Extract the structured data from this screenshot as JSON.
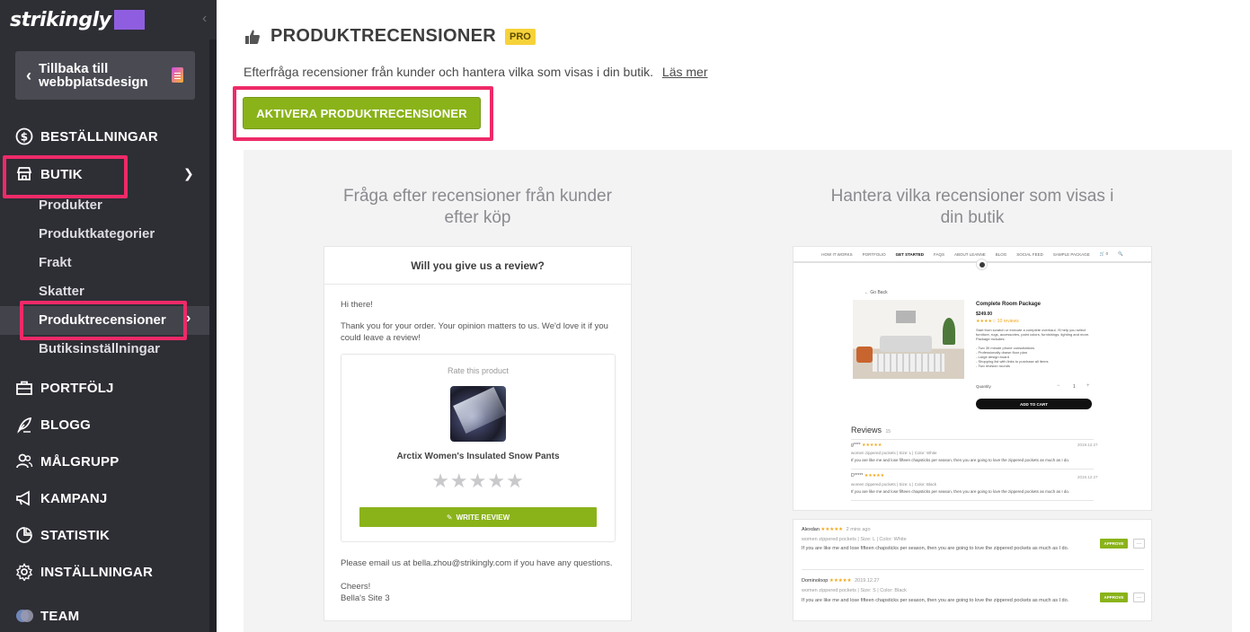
{
  "app": {
    "logo": "strikingly"
  },
  "sidebar": {
    "back_label": "Tillbaka till webbplatsdesign",
    "items": [
      {
        "label": "BESTÄLLNINGAR",
        "icon": "dollar-circle-icon"
      },
      {
        "label": "BUTIK",
        "icon": "store-icon"
      },
      {
        "label": "PORTFÖLJ",
        "icon": "briefcase-icon"
      },
      {
        "label": "BLOGG",
        "icon": "feather-icon"
      },
      {
        "label": "MÅLGRUPP",
        "icon": "users-icon"
      },
      {
        "label": "KAMPANJ",
        "icon": "megaphone-icon"
      },
      {
        "label": "STATISTIK",
        "icon": "pie-chart-icon"
      },
      {
        "label": "INSTÄLLNINGAR",
        "icon": "gear-icon"
      },
      {
        "label": "TEAM",
        "icon": "team-avatar-icon"
      }
    ],
    "butik_sub": [
      {
        "label": "Produkter"
      },
      {
        "label": "Produktkategorier"
      },
      {
        "label": "Frakt"
      },
      {
        "label": "Skatter"
      },
      {
        "label": "Produktrecensioner",
        "active": true
      },
      {
        "label": "Butiksinställningar"
      }
    ]
  },
  "header": {
    "title": "PRODUKTRECENSIONER",
    "badge": "PRO",
    "description": "Efterfråga recensioner från kunder och hantera vilka som visas i din butik.",
    "learn_more": "Läs mer",
    "activate_button": "AKTIVERA PRODUKTRECENSIONER"
  },
  "left_column": {
    "title": "Fråga efter recensioner från kunder efter köp",
    "email": {
      "heading": "Will you give us a review?",
      "greeting": "Hi there!",
      "body": "Thank you for your order. Your opinion matters to us. We'd love it if you could leave a review!",
      "rate_label": "Rate this product",
      "product_name": "Arctix Women's Insulated Snow Pants",
      "stars": "★★★★★",
      "write_review": "WRITE REVIEW",
      "footer": "Please email us at bella.zhou@strikingly.com if you have any questions.",
      "signoff": "Cheers!",
      "site": "Bella's Site 3"
    }
  },
  "right_column": {
    "title": "Hantera vilka recensioner som visas i din butik",
    "store_nav": [
      "HOW IT WORKS",
      "PORTFOLIO",
      "GET STARTED",
      "FAQS",
      "ABOUT LEANNE",
      "BLOG",
      "SOCIAL FEED",
      "SAMPLE PACKAGE",
      "🛒 0",
      "🔍"
    ],
    "go_back": "← Go Back",
    "product_title": "Complete Room Package",
    "price": "$249.00",
    "product_reviews_count": "★★★★☆ 10 reviews",
    "product_desc": "Start from scratch or execute a complete overhaul, I'll help you select furniture, rugs, accessories, paint colors, furnishings, lighting and more. Package includes:",
    "product_list": [
      "- Two 30 minute phone consultations",
      "- Professionally drawn floor plan",
      "- Large design board",
      "- Shopping list with links to purchase all items",
      "- Two revision rounds"
    ],
    "quantity_label": "Quantity",
    "quantity_value": "1",
    "add_to_cart": "ADD TO CART",
    "reviews_heading": "Reviews",
    "reviews_count": "15",
    "mini_reviews": [
      {
        "name": "g****",
        "stars": "★★★★★",
        "meta": "women zippered pockets  |  Size: L  |  Color: White",
        "date": "2019.12.27",
        "text": "If you are like me and lose fifteen chapsticks per season, then you are going to love the zippered pockets as much as I do."
      },
      {
        "name": "D*****",
        "stars": "★★★★★",
        "meta": "women zippered pockets  |  Size: L  |  Color: Black",
        "date": "2019.12.27",
        "text": "If you are like me and lose fifteen chapsticks per season, then you are going to love the zippered pockets as much as I do."
      }
    ],
    "admin_reviews": [
      {
        "name": "Alexdan",
        "stars": "★★★★★",
        "time": "2 mins ago",
        "meta": "women zippered pockets  |  Size: L  |  Color: White",
        "text": "If you are like me and lose fifteen chapsticks per season, then you are going to love the zippered pockets as much as I do.",
        "approve": "APPROVE",
        "more": "···"
      },
      {
        "name": "Dominoloop",
        "stars": "★★★★★",
        "time": "2019.12.27",
        "meta": "women zippered pockets  |  Size: S  |  Color: Black",
        "text": "If you are like me and lose fifteen chapsticks per season, then you are going to love the zippered pockets as much as I do.",
        "approve": "APPROVE",
        "more": "···"
      }
    ]
  },
  "colors": {
    "sidebar_bg": "#2e2e35",
    "accent_green": "#8ab31a",
    "highlight_pink": "#ee2a68",
    "pro_badge": "#f6d23a"
  }
}
